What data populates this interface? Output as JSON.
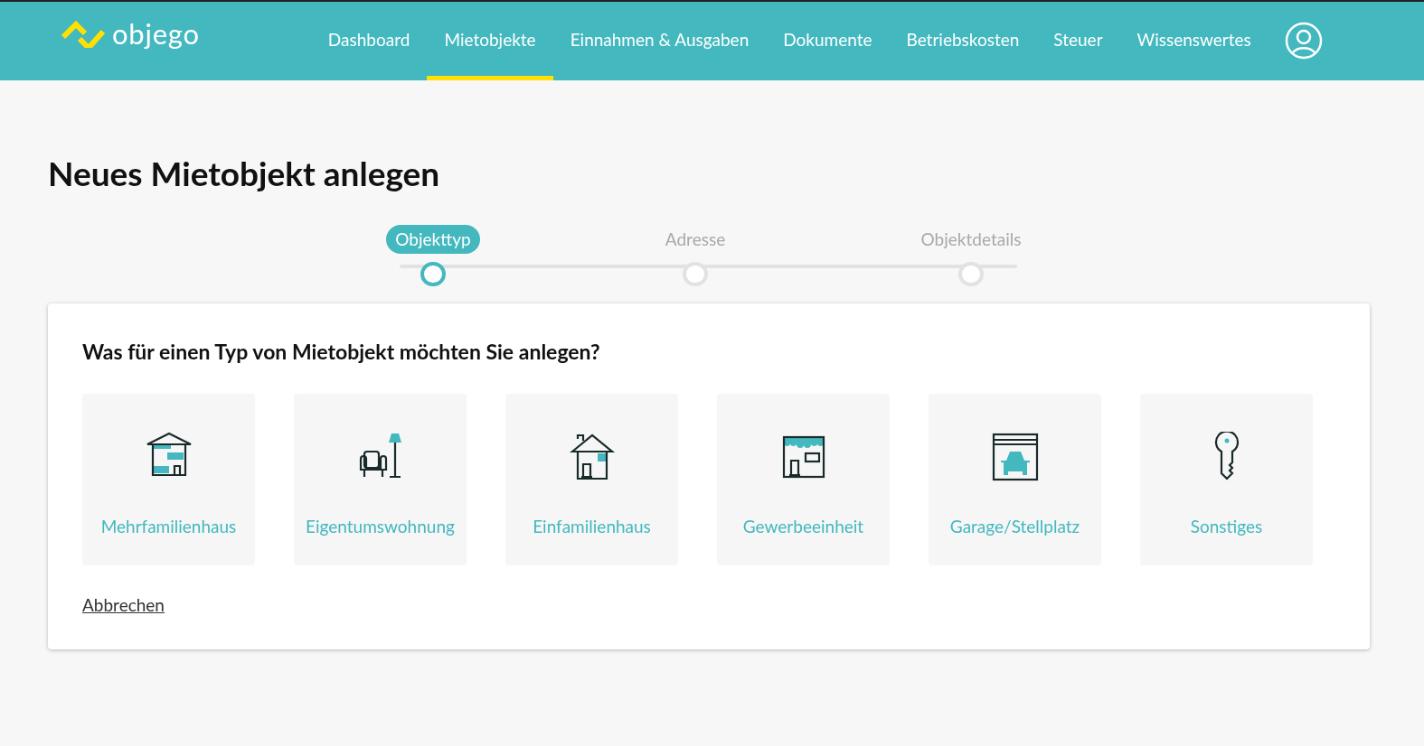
{
  "header": {
    "logo": "objego",
    "nav": [
      {
        "label": "Dashboard",
        "selected": false
      },
      {
        "label": "Mietobjekte",
        "selected": true
      },
      {
        "label": "Einnahmen & Ausgaben",
        "selected": false
      },
      {
        "label": "Dokumente",
        "selected": false
      },
      {
        "label": "Betriebskosten",
        "selected": false
      },
      {
        "label": "Steuer",
        "selected": false
      },
      {
        "label": "Wissenswertes",
        "selected": false
      }
    ]
  },
  "page_title": "Neues Mietobjekt anlegen",
  "stepper": [
    {
      "label": "Objekttyp",
      "selected": true
    },
    {
      "label": "Adresse",
      "selected": false
    },
    {
      "label": "Objektdetails",
      "selected": false
    }
  ],
  "card": {
    "question": "Was für einen Typ von Mietobjekt möchten Sie anlegen?",
    "types": [
      {
        "kind": "apartment-building",
        "label": "Mehrfamilienhaus"
      },
      {
        "kind": "condo",
        "label": "Eigentumswohnung"
      },
      {
        "kind": "house",
        "label": "Einfamilienhaus"
      },
      {
        "kind": "shop",
        "label": "Gewerbeeinheit"
      },
      {
        "kind": "garage",
        "label": "Garage/Stellplatz"
      },
      {
        "kind": "key",
        "label": "Sonstiges"
      }
    ],
    "cancel": "Abbrechen"
  }
}
